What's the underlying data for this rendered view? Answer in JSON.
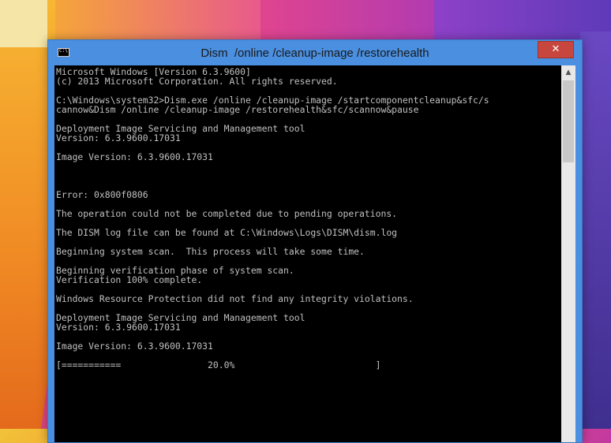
{
  "window": {
    "title": "Dism  /online /cleanup-image /restorehealth",
    "close_label": "✕"
  },
  "console": {
    "lines": [
      "Microsoft Windows [Version 6.3.9600]",
      "(c) 2013 Microsoft Corporation. All rights reserved.",
      "",
      "C:\\Windows\\system32>Dism.exe /online /cleanup-image /startcomponentcleanup&sfc/s",
      "cannow&Dism /online /cleanup-image /restorehealth&sfc/scannow&pause",
      "",
      "Deployment Image Servicing and Management tool",
      "Version: 6.3.9600.17031",
      "",
      "Image Version: 6.3.9600.17031",
      "",
      "",
      "",
      "Error: 0x800f0806",
      "",
      "The operation could not be completed due to pending operations.",
      "",
      "The DISM log file can be found at C:\\Windows\\Logs\\DISM\\dism.log",
      "",
      "Beginning system scan.  This process will take some time.",
      "",
      "Beginning verification phase of system scan.",
      "Verification 100% complete.",
      "",
      "Windows Resource Protection did not find any integrity violations.",
      "",
      "Deployment Image Servicing and Management tool",
      "Version: 6.3.9600.17031",
      "",
      "Image Version: 6.3.9600.17031",
      "",
      "[===========                20.0%                          ]"
    ]
  },
  "scrollbar": {
    "up_arrow": "▲"
  }
}
